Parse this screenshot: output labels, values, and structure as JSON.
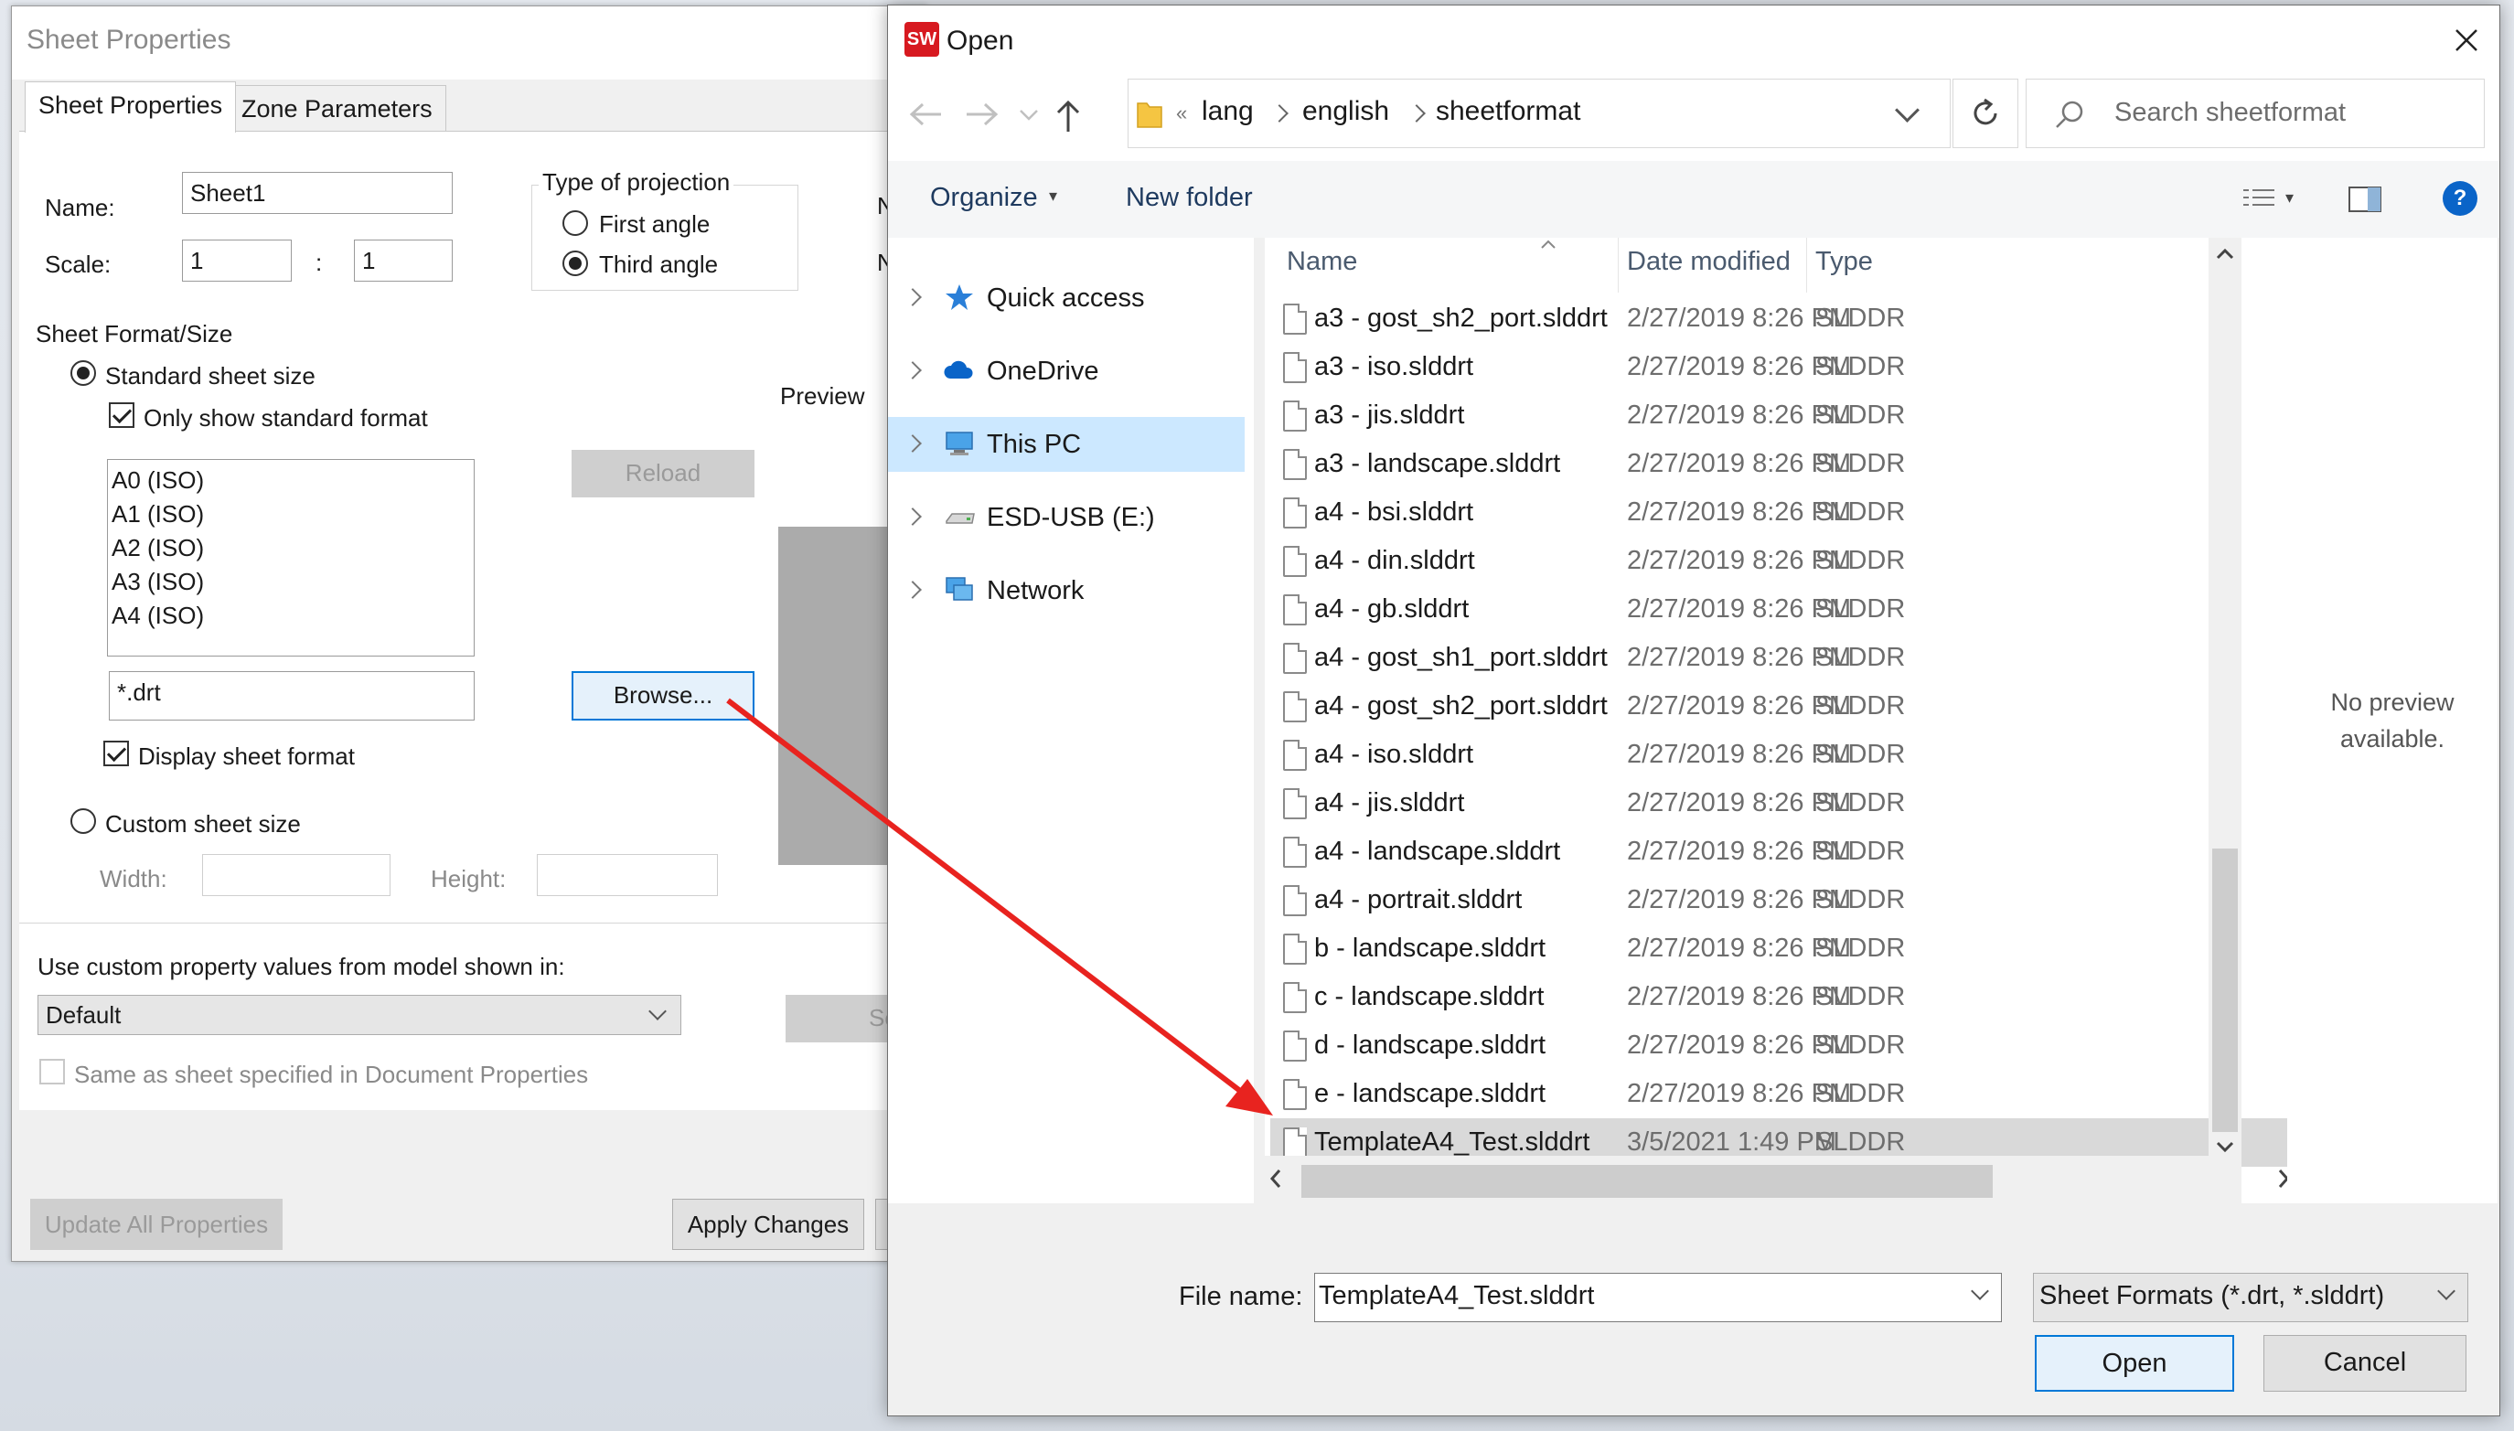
{
  "sheet_properties": {
    "title": "Sheet Properties",
    "tabs": [
      "Sheet Properties",
      "Zone Parameters"
    ],
    "name_label": "Name:",
    "name_value": "Sheet1",
    "scale_label": "Scale:",
    "scale_num": "1",
    "scale_sep": ":",
    "scale_den": "1",
    "projection_label": "Type of projection",
    "projection_options": [
      "First angle",
      "Third angle"
    ],
    "projection_selected": "Third angle",
    "clipped_label_1": "Ne",
    "clipped_label_2": "Ne",
    "format_size_label": "Sheet Format/Size",
    "standard_size_label": "Standard sheet size",
    "only_standard_label": "Only show standard format",
    "sizes": [
      "A0 (ISO)",
      "A1 (ISO)",
      "A2 (ISO)",
      "A3 (ISO)",
      "A4 (ISO)"
    ],
    "reload_label": "Reload",
    "preview_label": "Preview",
    "format_file_value": "*.drt",
    "browse_label": "Browse...",
    "display_format_label": "Display sheet format",
    "custom_size_label": "Custom sheet size",
    "width_label": "Width:",
    "height_label": "Height:",
    "custom_prop_label": "Use custom property values from model shown in:",
    "custom_prop_value": "Default",
    "select_btn_clipped": "Sel",
    "same_as_label": "Same as sheet specified in Document Properties",
    "update_all_label": "Update All Properties",
    "apply_label": "Apply Changes"
  },
  "open_dialog": {
    "title": "Open",
    "logo_text": "SW",
    "address": {
      "overflow": "«",
      "crumbs": [
        "lang",
        "english",
        "sheetformat"
      ]
    },
    "search_placeholder": "Search sheetformat",
    "toolbar": {
      "organize": "Organize",
      "new_folder": "New folder",
      "help": "?"
    },
    "nav_tree": [
      {
        "label": "Quick access",
        "icon": "star-icon"
      },
      {
        "label": "OneDrive",
        "icon": "cloud-icon"
      },
      {
        "label": "This PC",
        "icon": "computer-icon",
        "selected": true
      },
      {
        "label": "ESD-USB (E:)",
        "icon": "usb-drive-icon"
      },
      {
        "label": "Network",
        "icon": "network-icon"
      }
    ],
    "columns": {
      "name": "Name",
      "date": "Date modified",
      "type": "Type"
    },
    "files": [
      {
        "name": "a3 - gost_sh2_port.slddrt",
        "date": "2/27/2019 8:26 PM",
        "type": "SLDDR"
      },
      {
        "name": "a3 - iso.slddrt",
        "date": "2/27/2019 8:26 PM",
        "type": "SLDDR"
      },
      {
        "name": "a3 - jis.slddrt",
        "date": "2/27/2019 8:26 PM",
        "type": "SLDDR"
      },
      {
        "name": "a3 - landscape.slddrt",
        "date": "2/27/2019 8:26 PM",
        "type": "SLDDR"
      },
      {
        "name": "a4 - bsi.slddrt",
        "date": "2/27/2019 8:26 PM",
        "type": "SLDDR"
      },
      {
        "name": "a4 - din.slddrt",
        "date": "2/27/2019 8:26 PM",
        "type": "SLDDR"
      },
      {
        "name": "a4 - gb.slddrt",
        "date": "2/27/2019 8:26 PM",
        "type": "SLDDR"
      },
      {
        "name": "a4 - gost_sh1_port.slddrt",
        "date": "2/27/2019 8:26 PM",
        "type": "SLDDR"
      },
      {
        "name": "a4 - gost_sh2_port.slddrt",
        "date": "2/27/2019 8:26 PM",
        "type": "SLDDR"
      },
      {
        "name": "a4 - iso.slddrt",
        "date": "2/27/2019 8:26 PM",
        "type": "SLDDR"
      },
      {
        "name": "a4 - jis.slddrt",
        "date": "2/27/2019 8:26 PM",
        "type": "SLDDR"
      },
      {
        "name": "a4 - landscape.slddrt",
        "date": "2/27/2019 8:26 PM",
        "type": "SLDDR"
      },
      {
        "name": "a4 - portrait.slddrt",
        "date": "2/27/2019 8:26 PM",
        "type": "SLDDR"
      },
      {
        "name": "b - landscape.slddrt",
        "date": "2/27/2019 8:26 PM",
        "type": "SLDDR"
      },
      {
        "name": "c - landscape.slddrt",
        "date": "2/27/2019 8:26 PM",
        "type": "SLDDR"
      },
      {
        "name": "d - landscape.slddrt",
        "date": "2/27/2019 8:26 PM",
        "type": "SLDDR"
      },
      {
        "name": "e - landscape.slddrt",
        "date": "2/27/2019 8:26 PM",
        "type": "SLDDR"
      },
      {
        "name": "TemplateA4_Test.slddrt",
        "date": "3/5/2021 1:49 PM",
        "type": "SLDDR",
        "selected": true
      }
    ],
    "preview_text": [
      "No preview",
      "available."
    ],
    "file_name_label": "File name:",
    "file_name_value": "TemplateA4_Test.slddrt",
    "file_type_value": "Sheet Formats (*.drt, *.slddrt)",
    "open_label": "Open",
    "cancel_label": "Cancel"
  },
  "annotation": {
    "arrow_color": "#e8231f"
  },
  "colors": {
    "selection": "#cce8ff",
    "accent": "#0078d7",
    "row_selected": "#d9d9d9"
  }
}
